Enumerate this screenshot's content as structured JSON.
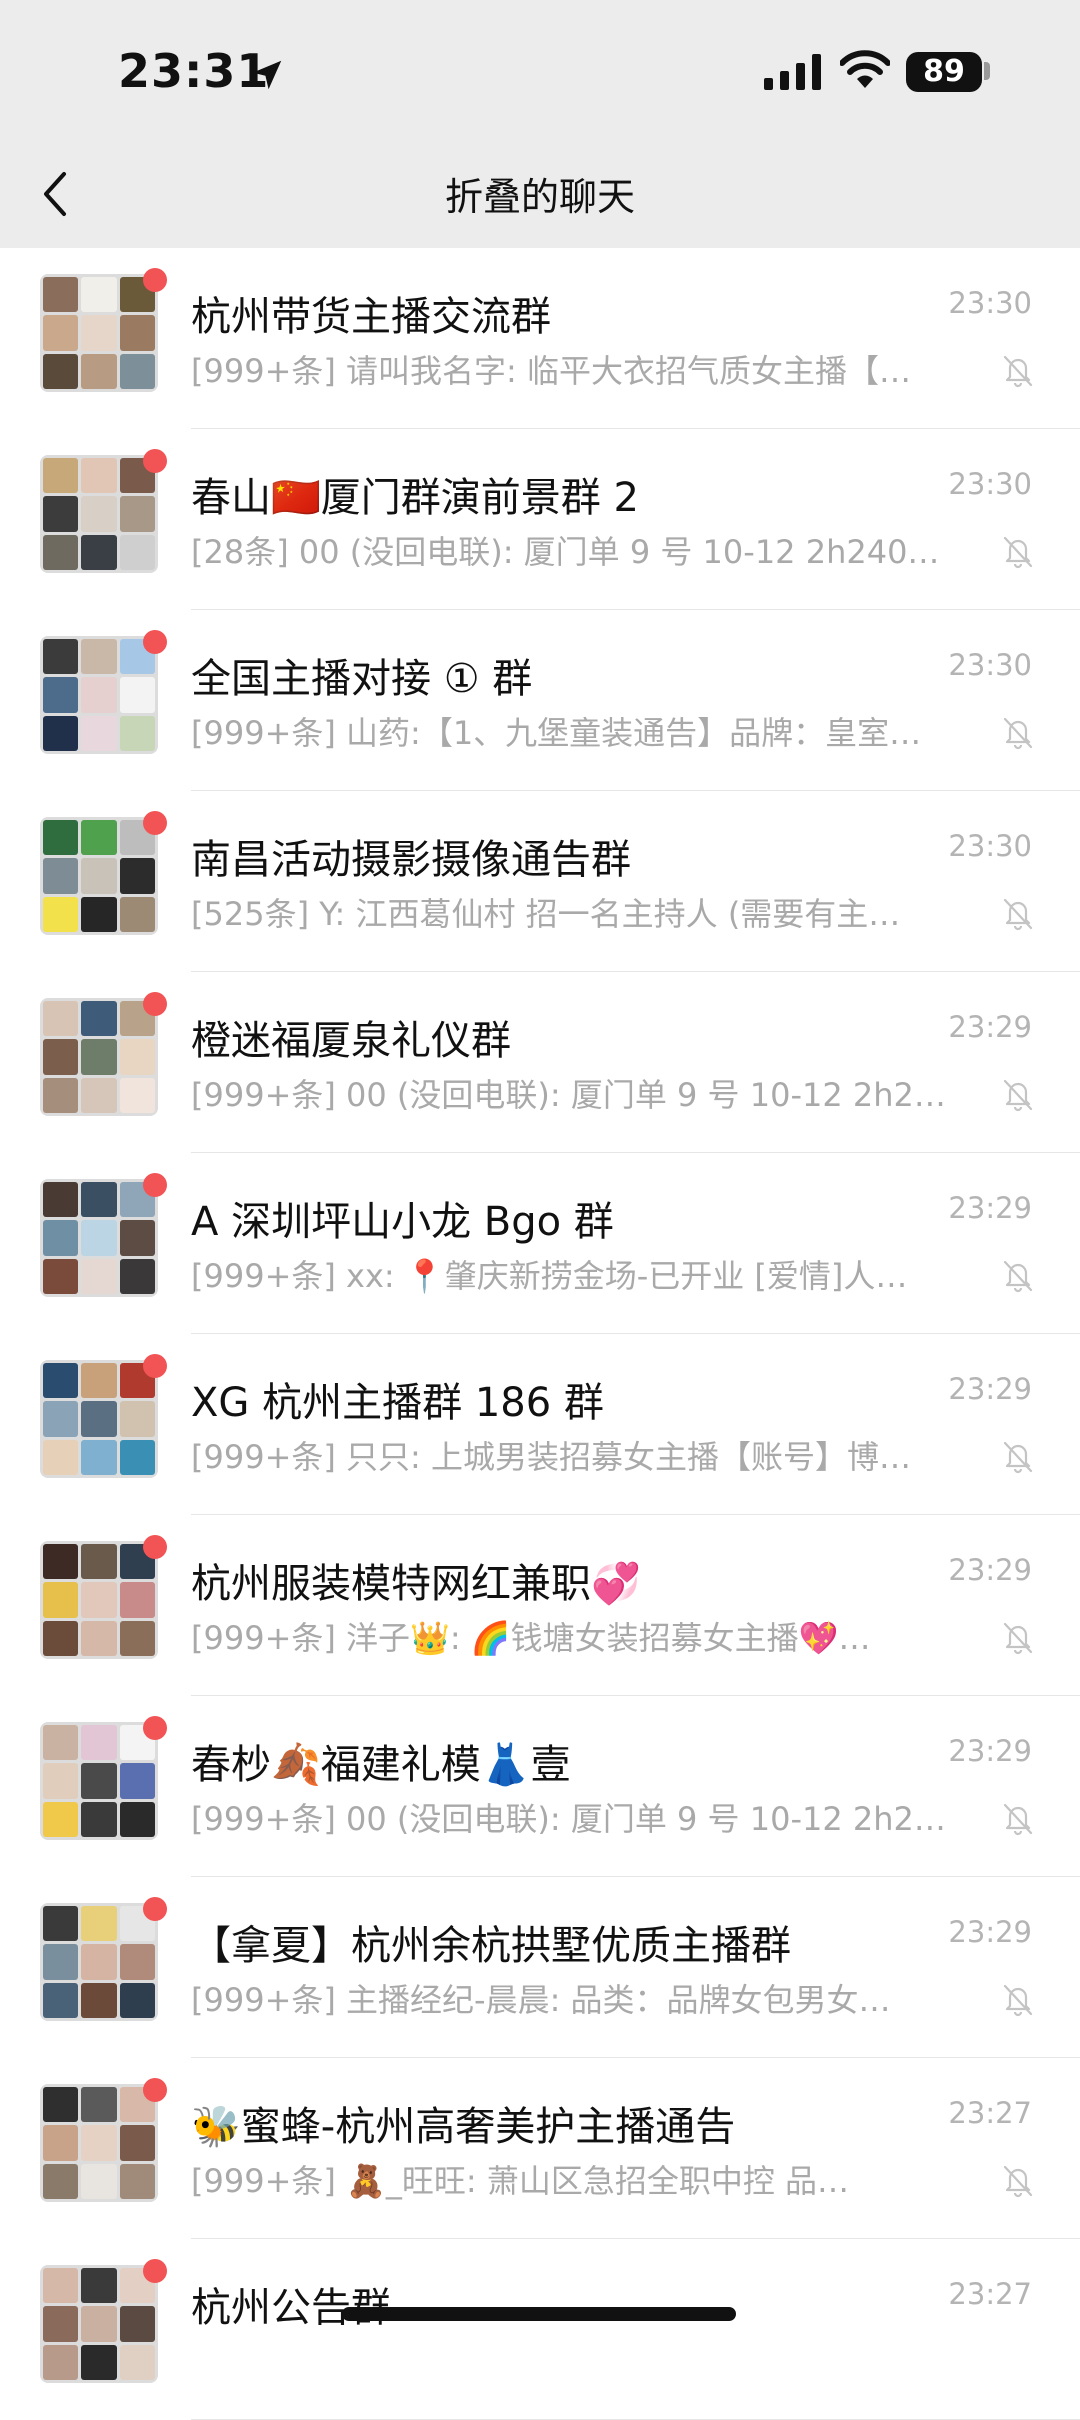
{
  "status": {
    "time": "23:31",
    "battery": "89"
  },
  "header": {
    "title": "折叠的聊天"
  },
  "chats": [
    {
      "name": "杭州带货主播交流群",
      "time": "23:30",
      "preview": "[999+条] 请叫我名字: 临平大衣招气质女主播【…",
      "colors": [
        "#8a6d5b",
        "#f0efe9",
        "#6b5a3a",
        "#c9a88b",
        "#e5d6c9",
        "#9a7b62",
        "#5a4a3a",
        "#b79b83",
        "#7d8f99"
      ]
    },
    {
      "name": "春山🇨🇳厦门群演前景群 2",
      "time": "23:30",
      "preview": "[28条] 00 (没回电联): 厦门单 9 号 10-12 2h240…",
      "colors": [
        "#c7a979",
        "#e2c6b5",
        "#7a5a4a",
        "#3c3c3c",
        "#d8cfc6",
        "#a79888",
        "#6f6a5f",
        "#3a3f46",
        "#cfcfcf"
      ]
    },
    {
      "name": "全国主播对接 ① 群",
      "time": "23:30",
      "preview": "[999+条] 山药:【1、九堡童装通告】品牌：皇室…",
      "colors": [
        "#3b3b3b",
        "#c9b8a8",
        "#a7c7e7",
        "#4d6b8a",
        "#e6cfcf",
        "#f3f3f3",
        "#21304a",
        "#e8d7dd",
        "#c6d6b6"
      ]
    },
    {
      "name": "南昌活动摄影摄像通告群",
      "time": "23:30",
      "preview": "[525条] Y: 江西葛仙村 招一名主持人 (需要有主…",
      "colors": [
        "#2f6d3f",
        "#4fa14d",
        "#bdbdbd",
        "#7e8d95",
        "#c8c2b8",
        "#2c2c2c",
        "#f2e14a",
        "#262626",
        "#9d8a74"
      ]
    },
    {
      "name": "橙迷福厦泉礼仪群",
      "time": "23:29",
      "preview": "[999+条] 00 (没回电联): 厦门单 9 号 10-12 2h2…",
      "colors": [
        "#d8c4b4",
        "#3f5b7a",
        "#b9a28a",
        "#7b5e4c",
        "#6d7d6a",
        "#e8d6c2",
        "#a68e7d",
        "#d6c6b9",
        "#f0e4dc"
      ]
    },
    {
      "name": "A 深圳坪山小龙 Bgo 群",
      "time": "23:29",
      "preview": "[999+条] xx: 📍肇庆新捞金场-已开业 [爱情]人…",
      "colors": [
        "#4a3a34",
        "#3a4f62",
        "#8ea6b8",
        "#6f8fa5",
        "#bcd5e5",
        "#5d4c43",
        "#7a4a3a",
        "#e5d8d2",
        "#3a3838"
      ]
    },
    {
      "name": "XG 杭州主播群 186 群",
      "time": "23:29",
      "preview": "[999+条] 只只: 上城男装招募女主播【账号】博…",
      "colors": [
        "#2a4c6e",
        "#c8a07a",
        "#b03a2e",
        "#8aa3b7",
        "#5b6f82",
        "#d1c2b0",
        "#e6d0b8",
        "#7fb0d0",
        "#3a8fb5"
      ]
    },
    {
      "name": "杭州服装模特网红兼职💞",
      "time": "23:29",
      "preview": "[999+条] 洋子👑: 🌈钱塘女装招募女主播💖…",
      "colors": [
        "#3e2a24",
        "#6a5a4c",
        "#2f3f4f",
        "#e6c04a",
        "#e2c8bb",
        "#c98a8a",
        "#6b4b3a",
        "#d6b8a8",
        "#8a6e5a"
      ]
    },
    {
      "name": "春杪🍂福建礼模👗壹",
      "time": "23:29",
      "preview": "[999+条] 00 (没回电联): 厦门单 9 号 10-12 2h2…",
      "colors": [
        "#c9b2a2",
        "#e3c6d6",
        "#f4f4f4",
        "#e0cdbb",
        "#4a4a4a",
        "#5a6fb0",
        "#f0c84a",
        "#3a3a3a",
        "#2a2a2a"
      ]
    },
    {
      "name": "【拿夏】杭州余杭拱墅优质主播群",
      "time": "23:29",
      "preview": "[999+条] 主播经纪-晨晨: 品类：品牌女包男女…",
      "colors": [
        "#3a3a3a",
        "#e8d07a",
        "#e6e6e6",
        "#7a8f9e",
        "#d6b4a4",
        "#b08a7a",
        "#4a6278",
        "#6b4a3a",
        "#2e3e4e"
      ]
    },
    {
      "name": "🐝蜜蜂-杭州高奢美护主播通告",
      "time": "23:27",
      "preview": "[999+条] 🧸_旺旺: 萧山区急招全职中控 品…",
      "colors": [
        "#2f2f2f",
        "#5a5a5a",
        "#d8b8a8",
        "#c9a28a",
        "#e6d2c4",
        "#7a5a4a",
        "#8a7a6a",
        "#e8e4e0",
        "#a08a7a"
      ]
    },
    {
      "name": "杭州公告群",
      "time": "23:27",
      "preview": "",
      "colors": [
        "#d6b8a8",
        "#3a3a3a",
        "#e4cfc4",
        "#8a6a5a",
        "#c9b0a0",
        "#5a4a42",
        "#b89a8a",
        "#2a2a2a",
        "#e0d0c4"
      ]
    }
  ]
}
